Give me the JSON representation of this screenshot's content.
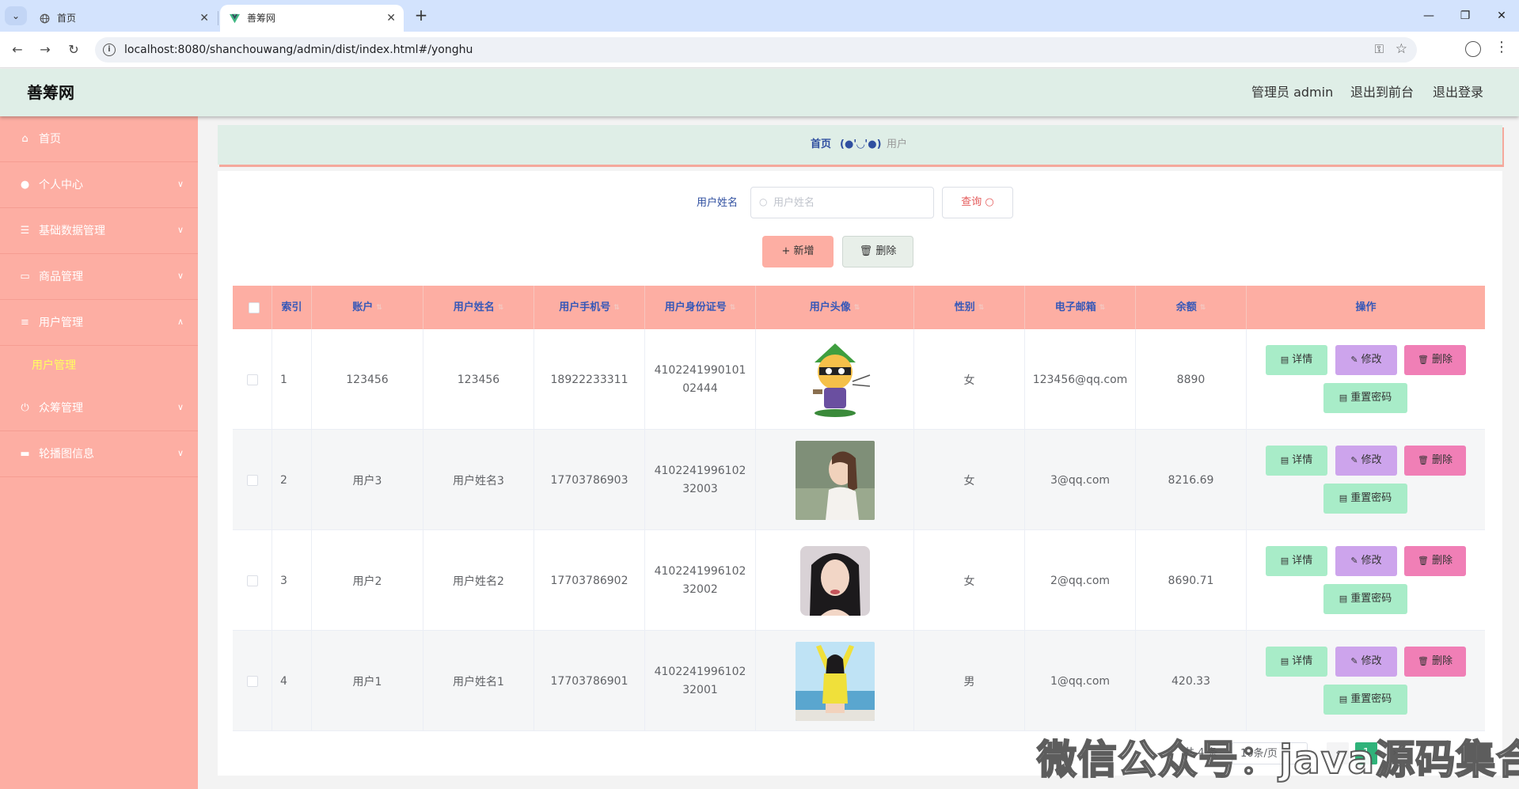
{
  "browser": {
    "tabs": [
      {
        "title": "首页",
        "icon": "globe-icon"
      },
      {
        "title": "善筹网",
        "icon": "vue-logo-icon"
      }
    ],
    "url": "localhost:8080/shanchouwang/admin/dist/index.html#/yonghu"
  },
  "header": {
    "title": "善筹网",
    "admin_label": "管理员 admin",
    "front_label": "退出到前台",
    "logout_label": "退出登录"
  },
  "sidebar": {
    "items": [
      {
        "label": "首页",
        "icon": "home-icon",
        "arrow": ""
      },
      {
        "label": "个人中心",
        "icon": "person-icon",
        "arrow": "chevron-down-icon"
      },
      {
        "label": "基础数据管理",
        "icon": "sliders-icon",
        "arrow": "chevron-down-icon"
      },
      {
        "label": "商品管理",
        "icon": "credit-card-icon",
        "arrow": "chevron-down-icon"
      },
      {
        "label": "用户管理",
        "icon": "menu-icon",
        "arrow": "chevron-up-icon"
      },
      {
        "label": "众筹管理",
        "icon": "power-icon",
        "arrow": "chevron-down-icon"
      },
      {
        "label": "轮播图信息",
        "icon": "monitor-icon",
        "arrow": "chevron-down-icon"
      }
    ],
    "active_sub": "用户管理"
  },
  "breadcrumb": {
    "home": "首页",
    "face": "(●'◡'●)",
    "current": "用户"
  },
  "search": {
    "label": "用户姓名",
    "placeholder": "用户姓名",
    "query_label": "查询"
  },
  "actions": {
    "add_label": "新增",
    "delete_label": "删除"
  },
  "table": {
    "columns": [
      "索引",
      "账户",
      "用户姓名",
      "用户手机号",
      "用户身份证号",
      "用户头像",
      "性别",
      "电子邮箱",
      "余额",
      "操作"
    ],
    "rows": [
      {
        "index": "1",
        "account": "123456",
        "name": "123456",
        "phone": "18922233311",
        "id_card": "410224199010102444",
        "avatar": "cartoon-ninja",
        "gender": "女",
        "email": "123456@qq.com",
        "balance": "8890"
      },
      {
        "index": "2",
        "account": "用户3",
        "name": "用户姓名3",
        "phone": "17703786903",
        "id_card": "410224199610232003",
        "avatar": "girl-profile",
        "gender": "女",
        "email": "3@qq.com",
        "balance": "8216.69"
      },
      {
        "index": "3",
        "account": "用户2",
        "name": "用户姓名2",
        "phone": "17703786902",
        "id_card": "410224199610232002",
        "avatar": "woman-pillow",
        "gender": "女",
        "email": "2@qq.com",
        "balance": "8690.71"
      },
      {
        "index": "4",
        "account": "用户1",
        "name": "用户姓名1",
        "phone": "17703786901",
        "id_card": "410224199610232001",
        "avatar": "girl-yellow",
        "gender": "男",
        "email": "1@qq.com",
        "balance": "420.33"
      }
    ],
    "row_actions": {
      "detail": "详情",
      "edit": "修改",
      "delete": "删除",
      "reset": "重置密码"
    }
  },
  "pagination": {
    "total": "共 4 条",
    "page_size": "10条/页",
    "current_page": "1"
  },
  "watermark": "微信公众号：java源码集合",
  "colors": {
    "header_bg": "#dfeee7",
    "sidebar_bg": "#fdaea3",
    "table_header_bg": "#fdaea3",
    "accent_blue": "#3658b8",
    "active_sub": "#ffff5f",
    "detail_btn": "#a8ecc8",
    "edit_btn": "#cda4ec",
    "delete_btn": "#f07fb6"
  }
}
